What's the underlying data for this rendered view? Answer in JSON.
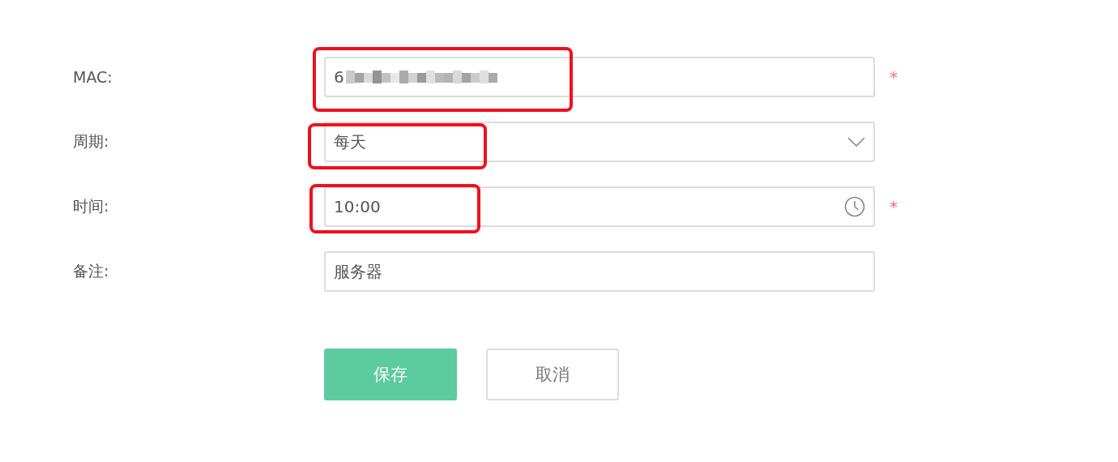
{
  "form": {
    "fields": [
      {
        "kind": "text",
        "label": "MAC:",
        "value": "6",
        "blurred": true,
        "required": true,
        "highlighted": true
      },
      {
        "kind": "select",
        "label": "周期:",
        "value": "每天",
        "required": false,
        "highlighted": true
      },
      {
        "kind": "time",
        "label": "时间:",
        "value": "10:00",
        "required": true,
        "highlighted": true
      },
      {
        "kind": "text",
        "label": "备注:",
        "value": "服务器",
        "required": false,
        "highlighted": false
      }
    ]
  },
  "required_mark": "*",
  "buttons": [
    {
      "kind": "primary",
      "label": "保存"
    },
    {
      "kind": "secondary",
      "label": "取消"
    }
  ]
}
